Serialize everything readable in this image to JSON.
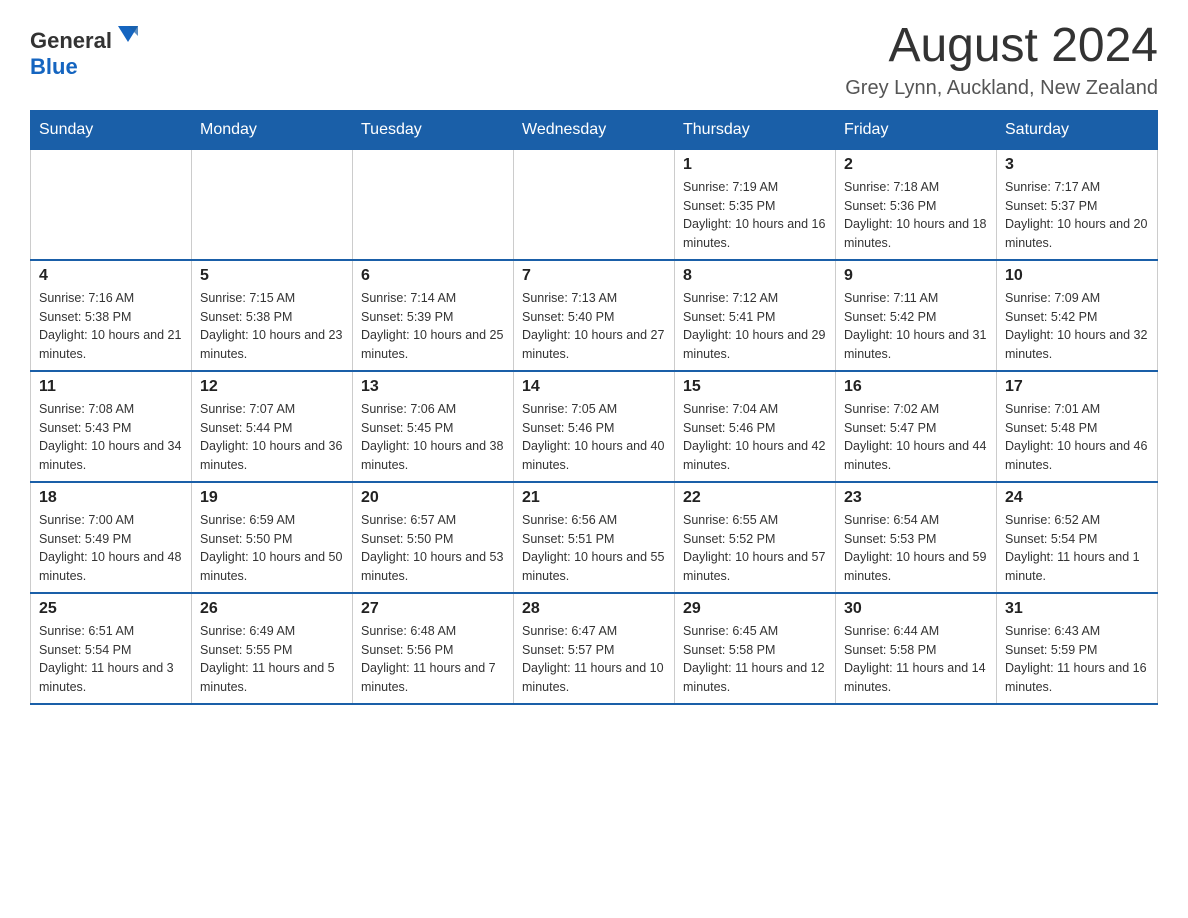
{
  "header": {
    "logo_general": "General",
    "logo_blue": "Blue",
    "month_year": "August 2024",
    "location": "Grey Lynn, Auckland, New Zealand"
  },
  "days_of_week": [
    "Sunday",
    "Monday",
    "Tuesday",
    "Wednesday",
    "Thursday",
    "Friday",
    "Saturday"
  ],
  "weeks": [
    {
      "days": [
        {
          "num": "",
          "info": ""
        },
        {
          "num": "",
          "info": ""
        },
        {
          "num": "",
          "info": ""
        },
        {
          "num": "",
          "info": ""
        },
        {
          "num": "1",
          "info": "Sunrise: 7:19 AM\nSunset: 5:35 PM\nDaylight: 10 hours and 16 minutes."
        },
        {
          "num": "2",
          "info": "Sunrise: 7:18 AM\nSunset: 5:36 PM\nDaylight: 10 hours and 18 minutes."
        },
        {
          "num": "3",
          "info": "Sunrise: 7:17 AM\nSunset: 5:37 PM\nDaylight: 10 hours and 20 minutes."
        }
      ]
    },
    {
      "days": [
        {
          "num": "4",
          "info": "Sunrise: 7:16 AM\nSunset: 5:38 PM\nDaylight: 10 hours and 21 minutes."
        },
        {
          "num": "5",
          "info": "Sunrise: 7:15 AM\nSunset: 5:38 PM\nDaylight: 10 hours and 23 minutes."
        },
        {
          "num": "6",
          "info": "Sunrise: 7:14 AM\nSunset: 5:39 PM\nDaylight: 10 hours and 25 minutes."
        },
        {
          "num": "7",
          "info": "Sunrise: 7:13 AM\nSunset: 5:40 PM\nDaylight: 10 hours and 27 minutes."
        },
        {
          "num": "8",
          "info": "Sunrise: 7:12 AM\nSunset: 5:41 PM\nDaylight: 10 hours and 29 minutes."
        },
        {
          "num": "9",
          "info": "Sunrise: 7:11 AM\nSunset: 5:42 PM\nDaylight: 10 hours and 31 minutes."
        },
        {
          "num": "10",
          "info": "Sunrise: 7:09 AM\nSunset: 5:42 PM\nDaylight: 10 hours and 32 minutes."
        }
      ]
    },
    {
      "days": [
        {
          "num": "11",
          "info": "Sunrise: 7:08 AM\nSunset: 5:43 PM\nDaylight: 10 hours and 34 minutes."
        },
        {
          "num": "12",
          "info": "Sunrise: 7:07 AM\nSunset: 5:44 PM\nDaylight: 10 hours and 36 minutes."
        },
        {
          "num": "13",
          "info": "Sunrise: 7:06 AM\nSunset: 5:45 PM\nDaylight: 10 hours and 38 minutes."
        },
        {
          "num": "14",
          "info": "Sunrise: 7:05 AM\nSunset: 5:46 PM\nDaylight: 10 hours and 40 minutes."
        },
        {
          "num": "15",
          "info": "Sunrise: 7:04 AM\nSunset: 5:46 PM\nDaylight: 10 hours and 42 minutes."
        },
        {
          "num": "16",
          "info": "Sunrise: 7:02 AM\nSunset: 5:47 PM\nDaylight: 10 hours and 44 minutes."
        },
        {
          "num": "17",
          "info": "Sunrise: 7:01 AM\nSunset: 5:48 PM\nDaylight: 10 hours and 46 minutes."
        }
      ]
    },
    {
      "days": [
        {
          "num": "18",
          "info": "Sunrise: 7:00 AM\nSunset: 5:49 PM\nDaylight: 10 hours and 48 minutes."
        },
        {
          "num": "19",
          "info": "Sunrise: 6:59 AM\nSunset: 5:50 PM\nDaylight: 10 hours and 50 minutes."
        },
        {
          "num": "20",
          "info": "Sunrise: 6:57 AM\nSunset: 5:50 PM\nDaylight: 10 hours and 53 minutes."
        },
        {
          "num": "21",
          "info": "Sunrise: 6:56 AM\nSunset: 5:51 PM\nDaylight: 10 hours and 55 minutes."
        },
        {
          "num": "22",
          "info": "Sunrise: 6:55 AM\nSunset: 5:52 PM\nDaylight: 10 hours and 57 minutes."
        },
        {
          "num": "23",
          "info": "Sunrise: 6:54 AM\nSunset: 5:53 PM\nDaylight: 10 hours and 59 minutes."
        },
        {
          "num": "24",
          "info": "Sunrise: 6:52 AM\nSunset: 5:54 PM\nDaylight: 11 hours and 1 minute."
        }
      ]
    },
    {
      "days": [
        {
          "num": "25",
          "info": "Sunrise: 6:51 AM\nSunset: 5:54 PM\nDaylight: 11 hours and 3 minutes."
        },
        {
          "num": "26",
          "info": "Sunrise: 6:49 AM\nSunset: 5:55 PM\nDaylight: 11 hours and 5 minutes."
        },
        {
          "num": "27",
          "info": "Sunrise: 6:48 AM\nSunset: 5:56 PM\nDaylight: 11 hours and 7 minutes."
        },
        {
          "num": "28",
          "info": "Sunrise: 6:47 AM\nSunset: 5:57 PM\nDaylight: 11 hours and 10 minutes."
        },
        {
          "num": "29",
          "info": "Sunrise: 6:45 AM\nSunset: 5:58 PM\nDaylight: 11 hours and 12 minutes."
        },
        {
          "num": "30",
          "info": "Sunrise: 6:44 AM\nSunset: 5:58 PM\nDaylight: 11 hours and 14 minutes."
        },
        {
          "num": "31",
          "info": "Sunrise: 6:43 AM\nSunset: 5:59 PM\nDaylight: 11 hours and 16 minutes."
        }
      ]
    }
  ]
}
